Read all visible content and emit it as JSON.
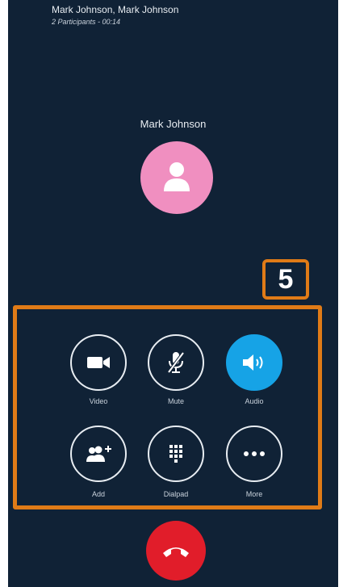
{
  "header": {
    "title": "Mark Johnson, Mark Johnson",
    "subtitle": "2 Participants - 00:14"
  },
  "participant": {
    "name": "Mark Johnson",
    "avatar_color": "#f08fc0"
  },
  "callout": {
    "number": "5",
    "color": "#e07b17"
  },
  "controls": [
    {
      "label": "Video",
      "icon": "video-camera-icon"
    },
    {
      "label": "Mute",
      "icon": "microphone-muted-icon"
    },
    {
      "label": "Audio",
      "icon": "speaker-icon",
      "active": true
    },
    {
      "label": "Add",
      "icon": "add-person-icon"
    },
    {
      "label": "Dialpad",
      "icon": "dialpad-icon"
    },
    {
      "label": "More",
      "icon": "more-dots-icon"
    }
  ],
  "hangup": {
    "icon": "end-call-icon",
    "color": "#e11d2a"
  },
  "colors": {
    "background": "#102236",
    "accent": "#16a3e6"
  }
}
